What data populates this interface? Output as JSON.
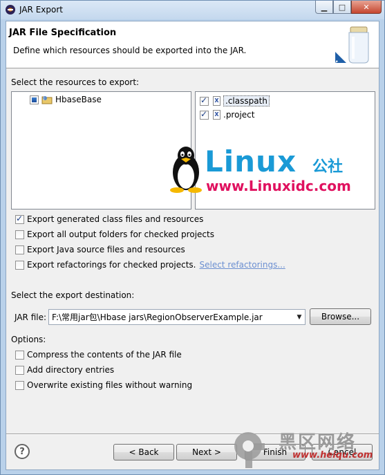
{
  "window": {
    "title": "JAR Export",
    "minimize_label": "▁",
    "maximize_label": "□",
    "close_label": "✕"
  },
  "header": {
    "title": "JAR File Specification",
    "description": "Define which resources should be exported into the JAR."
  },
  "resources": {
    "label": "Select the resources to export:",
    "tree": [
      {
        "label": "HbaseBase",
        "state": "partial"
      }
    ],
    "files": [
      {
        "label": ".classpath",
        "checked": true
      },
      {
        "label": ".project",
        "checked": true
      }
    ]
  },
  "export_options": [
    {
      "label": "Export generated class files and resources",
      "checked": true
    },
    {
      "label": "Export all output folders for checked projects",
      "checked": false
    },
    {
      "label": "Export Java source files and resources",
      "checked": false
    },
    {
      "label": "Export refactorings for checked projects.",
      "checked": false,
      "link": "Select refactorings..."
    }
  ],
  "destination": {
    "label": "Select the export destination:",
    "jar_file_label": "JAR file:",
    "jar_file_value": "F:\\常用jar包\\Hbase jars\\RegionObserverExample.jar",
    "browse_label": "Browse..."
  },
  "options": {
    "label": "Options:",
    "items": [
      {
        "label": "Compress the contents of the JAR file",
        "checked": false
      },
      {
        "label": "Add directory entries",
        "checked": false
      },
      {
        "label": "Overwrite existing files without warning",
        "checked": false
      }
    ]
  },
  "footer": {
    "help_label": "?",
    "back_label": "< Back",
    "next_label": "Next >",
    "finish_label": "Finish",
    "cancel_label": "Cancel"
  },
  "watermarks": {
    "linux_text": "Linux",
    "linux_cn": "公社",
    "linux_url": "www.Linuxidc.com",
    "corner_cn": "黑区网络",
    "corner_url": "www.heiqu.com"
  },
  "colors": {
    "titlebar": "#c4d8ee",
    "dialog_bg": "#f0f0f0",
    "watermark_blue": "#1a9ad6",
    "watermark_red": "#e0115f"
  }
}
